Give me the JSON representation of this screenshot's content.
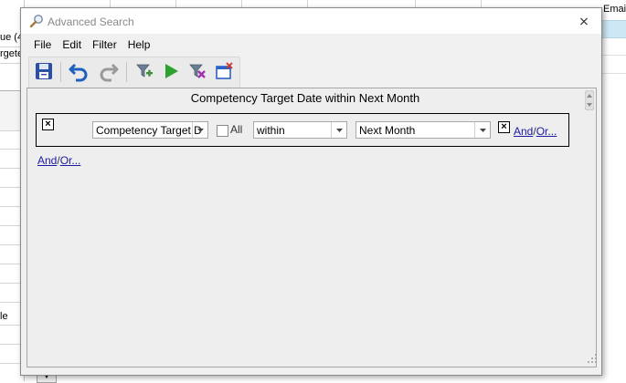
{
  "background": {
    "left_cells": [
      "ue (4",
      "rgete",
      "",
      "",
      "",
      "",
      "",
      "",
      "",
      "",
      "",
      "",
      "",
      "le",
      "",
      ""
    ],
    "right_header": "Email"
  },
  "dialog": {
    "title": "Advanced Search",
    "title_icon": "magnifier-icon",
    "close_label": "⨯",
    "menu": [
      "File",
      "Edit",
      "Filter",
      "Help"
    ],
    "toolbar": [
      {
        "name": "save-icon",
        "color": "#2b4fa8"
      },
      {
        "name": "undo-icon",
        "color": "#1f5fbf"
      },
      {
        "name": "redo-icon",
        "color": "#9a9a9a"
      },
      {
        "name": "add-filter-icon",
        "color": "#3d8f3d"
      },
      {
        "name": "run-icon",
        "color": "#2fa12f"
      },
      {
        "name": "clear-filter-icon",
        "color": "#a12fb0"
      },
      {
        "name": "new-window-icon",
        "color": "#2a62c9"
      }
    ],
    "summary": "Competency Target Date within Next Month",
    "condition": {
      "remove_label": "×",
      "field": "Competency Target D",
      "all_label": "All",
      "all_checked": false,
      "operator": "within",
      "value": "Next Month",
      "value_remove_label": "×",
      "and_label": "And",
      "or_label": "Or..."
    },
    "group_and_label": "And",
    "group_or_label": "Or..."
  }
}
